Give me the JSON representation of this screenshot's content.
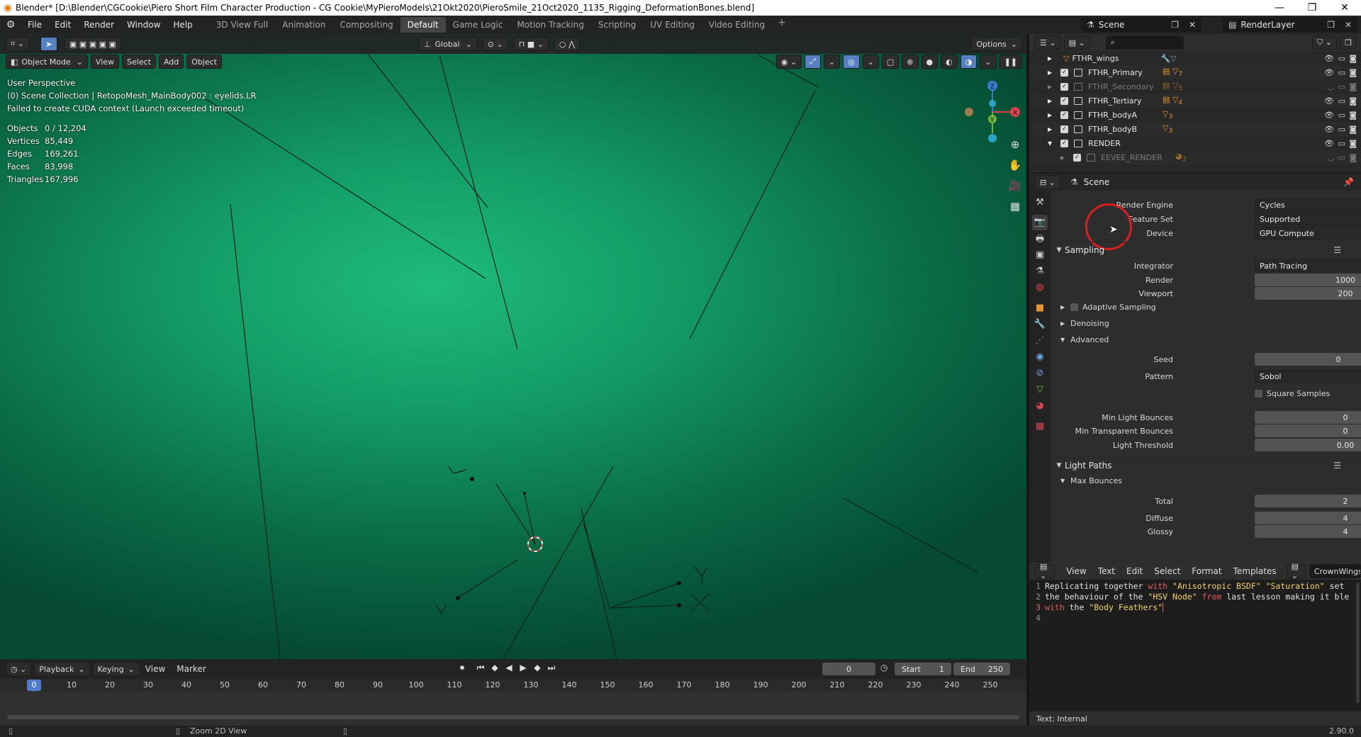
{
  "window": {
    "title": "Blender* [D:\\Blender\\CGCookie\\Piero Short Film Character Production - CG Cookie\\MyPieroModels\\21Okt2020\\PieroSmile_21Oct2020_1135_Rigging_DeformationBones.blend]",
    "minimize": "—",
    "maximize": "❐",
    "close": "✕"
  },
  "menu": {
    "file": "File",
    "edit": "Edit",
    "render": "Render",
    "window": "Window",
    "help": "Help"
  },
  "workspaces": [
    "3D View Full",
    "Animation",
    "Compositing",
    "Default",
    "Game Logic",
    "Motion Tracking",
    "Scripting",
    "UV Editing",
    "Video Editing"
  ],
  "active_workspace": "Default",
  "scene": {
    "name": "Scene",
    "render_layer": "RenderLayer"
  },
  "viewport": {
    "transform_orientation": "Global",
    "options": "Options",
    "mode": "Object Mode",
    "menu_view": "View",
    "menu_select": "Select",
    "menu_add": "Add",
    "menu_object": "Object",
    "perspective": "User Perspective",
    "collection_info": "(0) Scene Collection | RetopoMesh_MainBody002 : eyelids.LR",
    "error": "Failed to create CUDA context (Launch exceeded timeout)",
    "stats": [
      {
        "label": "Objects",
        "value": "0 / 12,204"
      },
      {
        "label": "Vertices",
        "value": "85,449"
      },
      {
        "label": "Edges",
        "value": "169,261"
      },
      {
        "label": "Faces",
        "value": "83,998"
      },
      {
        "label": "Triangles",
        "value": "167,996"
      }
    ],
    "gizmo": {
      "z": "Z",
      "x": "X",
      "y": "Y"
    },
    "bg_color": "#1fbb7d"
  },
  "timeline": {
    "playback": "Playback",
    "keying": "Keying",
    "view": "View",
    "marker": "Marker",
    "current_frame": "0",
    "start_label": "Start",
    "start": "1",
    "end_label": "End",
    "end": "250",
    "ticks": [
      "10",
      "20",
      "30",
      "40",
      "50",
      "60",
      "70",
      "80",
      "90",
      "100",
      "110",
      "120",
      "130",
      "140",
      "150",
      "160",
      "170",
      "180",
      "190",
      "200",
      "210",
      "220",
      "230",
      "240",
      "250"
    ],
    "playhead": "0"
  },
  "statusbar": {
    "hint": "Zoom 2D View",
    "version": "2.90.0"
  },
  "outliner": {
    "items": [
      {
        "name": "FTHR_wings",
        "dim": false
      },
      {
        "name": "FTHR_Primary",
        "dim": false
      },
      {
        "name": "FTHR_Secondary",
        "dim": true
      },
      {
        "name": "FTHR_Tertiary",
        "dim": false
      },
      {
        "name": "FTHR_bodyA",
        "dim": false
      },
      {
        "name": "FTHR_bodyB",
        "dim": false
      },
      {
        "name": "RENDER",
        "dim": false
      },
      {
        "name": "EEVEE_RENDER",
        "dim": true
      }
    ],
    "badges": [
      "7",
      "5",
      "4",
      "3",
      "3",
      "3"
    ]
  },
  "properties": {
    "context": "Scene",
    "render_engine_label": "Render Engine",
    "render_engine": "Cycles",
    "feature_set_label": "Feature Set",
    "feature_set": "Supported",
    "device_label": "Device",
    "device": "GPU Compute",
    "sampling": "Sampling",
    "integrator_label": "Integrator",
    "integrator": "Path Tracing",
    "render_label": "Render",
    "render": "1000",
    "viewport_label": "Viewport",
    "viewport": "200",
    "adaptive_sampling": "Adaptive Sampling",
    "denoising": "Denoising",
    "advanced": "Advanced",
    "seed_label": "Seed",
    "seed": "0",
    "pattern_label": "Pattern",
    "pattern": "Sobol",
    "square_samples": "Square Samples",
    "min_light_bounces_label": "Min Light Bounces",
    "min_light_bounces": "0",
    "min_transparent_bounces_label": "Min Transparent Bounces",
    "min_transparent_bounces": "0",
    "light_threshold_label": "Light Threshold",
    "light_threshold": "0.00",
    "light_paths": "Light Paths",
    "max_bounces": "Max Bounces",
    "total_label": "Total",
    "total": "2",
    "diffuse_label": "Diffuse",
    "diffuse": "4",
    "glossy_label": "Glossy",
    "glossy": "4"
  },
  "text_editor": {
    "view": "View",
    "text": "Text",
    "edit": "Edit",
    "select": "Select",
    "format": "Format",
    "templates": "Templates",
    "file_name": "CrownWingsTailAnim",
    "footer": "Text: Internal",
    "line_numbers": [
      "1",
      "2",
      "3",
      "4"
    ]
  }
}
